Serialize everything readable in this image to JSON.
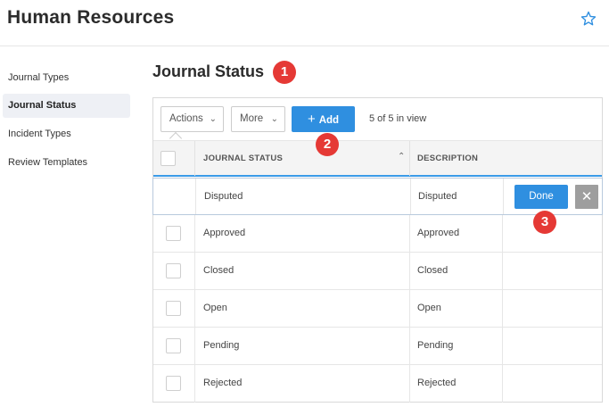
{
  "header": {
    "title": "Human Resources",
    "star_icon": "star-icon"
  },
  "sidebar": {
    "items": [
      {
        "label": "Journal Types",
        "active": false
      },
      {
        "label": "Journal Status",
        "active": true
      },
      {
        "label": "Incident Types",
        "active": false
      },
      {
        "label": "Review Templates",
        "active": false
      }
    ]
  },
  "page": {
    "title": "Journal Status"
  },
  "callouts": [
    "1",
    "2",
    "3"
  ],
  "toolbar": {
    "actions_label": "Actions",
    "more_label": "More",
    "add_label": "Add",
    "count_text": "5 of 5 in view"
  },
  "table": {
    "columns": [
      "JOURNAL STATUS",
      "DESCRIPTION"
    ],
    "edit_row": {
      "status": "Disputed",
      "description": "Disputed",
      "done_label": "Done"
    },
    "rows": [
      {
        "status": "Approved",
        "description": "Approved"
      },
      {
        "status": "Closed",
        "description": "Closed"
      },
      {
        "status": "Open",
        "description": "Open"
      },
      {
        "status": "Pending",
        "description": "Pending"
      },
      {
        "status": "Rejected",
        "description": "Rejected"
      }
    ]
  },
  "colors": {
    "accent": "#2f8fe0",
    "callout": "#e53935",
    "active_bg": "#eef0f5"
  }
}
